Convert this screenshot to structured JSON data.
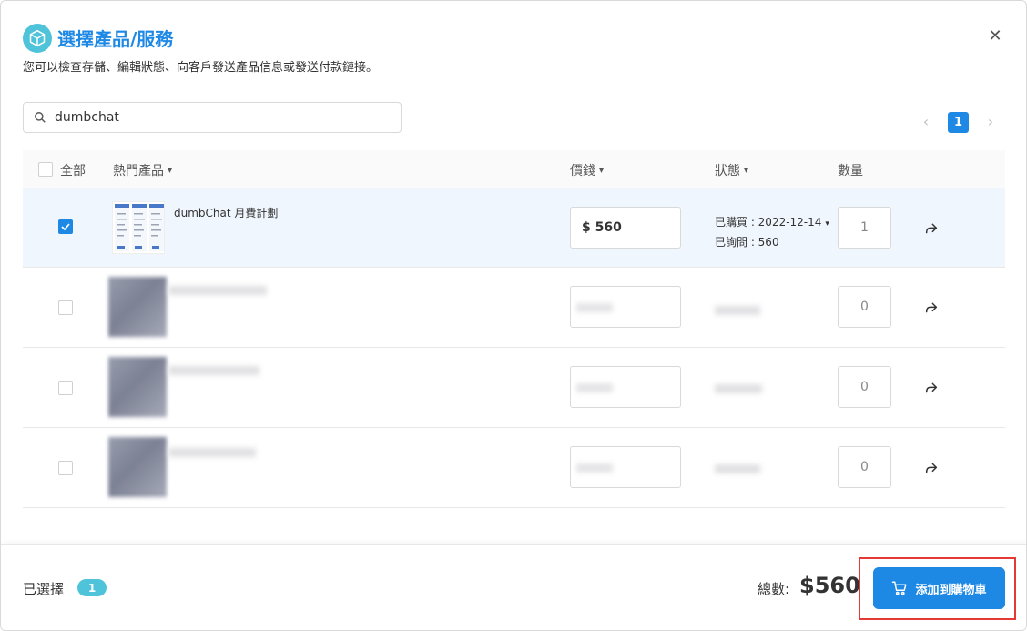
{
  "header": {
    "title": "選擇產品/服務",
    "description": "您可以檢查存儲、編輯狀態、向客戶發送產品信息或發送付款鏈接。",
    "icon": "box-icon"
  },
  "search": {
    "value": "dumbchat"
  },
  "pagination": {
    "current_page": "1"
  },
  "table": {
    "headers": {
      "select_all": "全部",
      "product": "熱門產品",
      "price": "價錢",
      "status": "狀態",
      "quantity": "數量"
    },
    "rows": [
      {
        "selected": true,
        "name": "dumbChat 月費計劃",
        "price": "$ 560",
        "purchased": "已購買 : 2022-12-14",
        "inquired": "已詢問 : 560",
        "quantity": "1"
      },
      {
        "selected": false,
        "quantity": "0"
      },
      {
        "selected": false,
        "quantity": "0"
      },
      {
        "selected": false,
        "quantity": "0"
      }
    ]
  },
  "footer": {
    "selected_label": "已選擇",
    "selected_count": "1",
    "total_label": "總數:",
    "total_value": "$560",
    "add_to_cart_label": "添加到購物車"
  },
  "colors": {
    "accent": "#1e88e5",
    "teal": "#4fc3d9",
    "highlight": "#e53935"
  }
}
